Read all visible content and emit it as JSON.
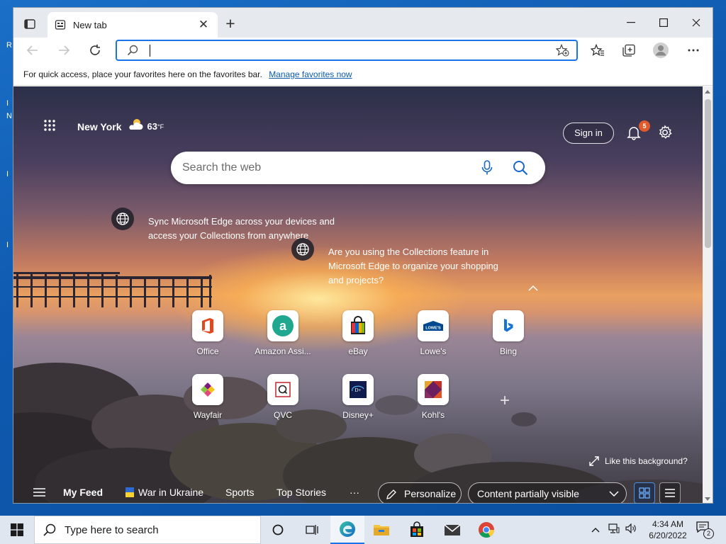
{
  "desktop": {
    "edge_letters": [
      "R",
      "I",
      "N",
      "I",
      "I"
    ]
  },
  "browser": {
    "tab": {
      "title": "New tab"
    },
    "address": {
      "value": "",
      "placeholder": ""
    },
    "favorites_bar": {
      "message": "For quick access, place your favorites here on the favorites bar.",
      "link": "Manage favorites now"
    }
  },
  "newtab": {
    "weather": {
      "city": "New York",
      "temp": "63",
      "unit": "°F"
    },
    "signin_label": "Sign in",
    "notifications_count": "5",
    "search": {
      "placeholder": "Search the web"
    },
    "promos": [
      {
        "text": "Sync Microsoft Edge across your devices and access your Collections from anywhere"
      },
      {
        "text": "Are you using the Collections feature in Microsoft Edge to organize your shopping and projects?"
      }
    ],
    "quick_links": [
      {
        "label": "Office",
        "icon": "office-icon"
      },
      {
        "label": "Amazon Assi...",
        "icon": "amazon-icon"
      },
      {
        "label": "eBay",
        "icon": "ebay-icon"
      },
      {
        "label": "Lowe's",
        "icon": "lowes-icon"
      },
      {
        "label": "Bing",
        "icon": "bing-icon"
      },
      {
        "label": "Wayfair",
        "icon": "wayfair-icon"
      },
      {
        "label": "QVC",
        "icon": "qvc-icon"
      },
      {
        "label": "Disney+",
        "icon": "disney-icon"
      },
      {
        "label": "Kohl's",
        "icon": "kohls-icon"
      }
    ],
    "like_background": "Like this background?",
    "feed": {
      "my_feed": "My Feed",
      "items": [
        "War in Ukraine",
        "Sports",
        "Top Stories"
      ],
      "more": "···",
      "personalize": "Personalize",
      "content_visibility": "Content partially visible"
    }
  },
  "taskbar": {
    "search_placeholder": "Type here to search",
    "time": "4:34 AM",
    "date": "6/20/2022",
    "notification_count": "2"
  }
}
